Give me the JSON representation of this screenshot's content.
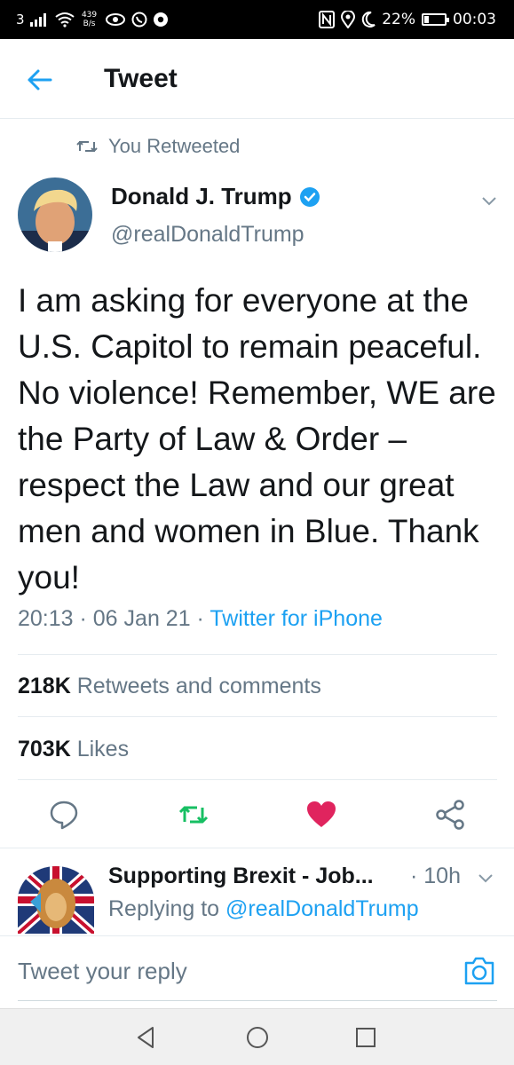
{
  "status_bar": {
    "sim": "3",
    "net_speed_value": "439",
    "net_speed_unit": "B/s",
    "battery": "22%",
    "battery_level": 0.22,
    "time": "00:03"
  },
  "header": {
    "title": "Tweet"
  },
  "retweet_context": {
    "label": "You Retweeted"
  },
  "author": {
    "name": "Donald J. Trump",
    "handle": "@realDonaldTrump",
    "verified": true
  },
  "tweet": {
    "text": "I am asking for everyone at the U.S. Capitol to remain peaceful. No violence! Remember, WE are the Party of Law & Order – respect the Law and our great men and women in Blue. Thank you!",
    "time": "20:13",
    "date": "06 Jan 21",
    "source": "Twitter for iPhone",
    "sep1": " · ",
    "sep2": " · "
  },
  "stats": {
    "retweets_count": "218K",
    "retweets_label": "Retweets and comments",
    "likes_count": "703K",
    "likes_label": "Likes"
  },
  "actions": {
    "reply_icon": "comment-icon",
    "retweet_icon": "retweet-icon",
    "like_icon": "heart-icon",
    "share_icon": "share-icon",
    "retweet_color": "#17bf63",
    "like_color": "#e0245e"
  },
  "reply": {
    "name": "Supporting Brexit - Job...",
    "time": "· 10h",
    "replying_prefix": "Replying to ",
    "replying_handle": "@realDonaldTrump"
  },
  "compose": {
    "placeholder": "Tweet your reply"
  },
  "colors": {
    "accent": "#1da1f2",
    "secondary_text": "#657786"
  }
}
